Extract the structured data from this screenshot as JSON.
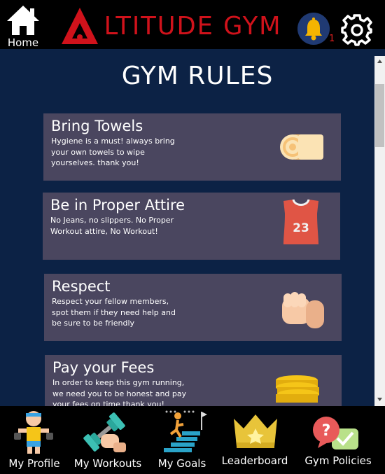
{
  "header": {
    "home_label": "Home",
    "brand_name": "LTITUDE GYM",
    "notification_count": "1",
    "brand_color": "#d0121b"
  },
  "page": {
    "title": "GYM RULES"
  },
  "rules": [
    {
      "title": "Bring Towels",
      "text": "Hygiene is a must! always bring your own towels to wipe yourselves. thank you!",
      "icon": "towel-icon"
    },
    {
      "title": "Be in Proper Attire",
      "text": "No Jeans, no slippers. No Proper Workout attire, No Workout!",
      "icon": "jersey-icon",
      "jersey_number": "23"
    },
    {
      "title": "Respect",
      "text": "Respect your fellow members, spot them if they need help and be sure to be friendly",
      "icon": "fist-icon"
    },
    {
      "title": "Pay your Fees",
      "text": "In order to keep this gym running, we need you to be honest and pay your fees on time thank you!",
      "icon": "coins-icon"
    }
  ],
  "nav": [
    {
      "label": "My Profile",
      "icon": "profile-icon"
    },
    {
      "label": "My Workouts",
      "icon": "dumbbell-icon"
    },
    {
      "label": "My Goals",
      "icon": "goals-stairs-icon"
    },
    {
      "label": "Leaderboard",
      "icon": "crown-icon"
    },
    {
      "label": "Gym Policies",
      "icon": "policies-icon"
    }
  ]
}
